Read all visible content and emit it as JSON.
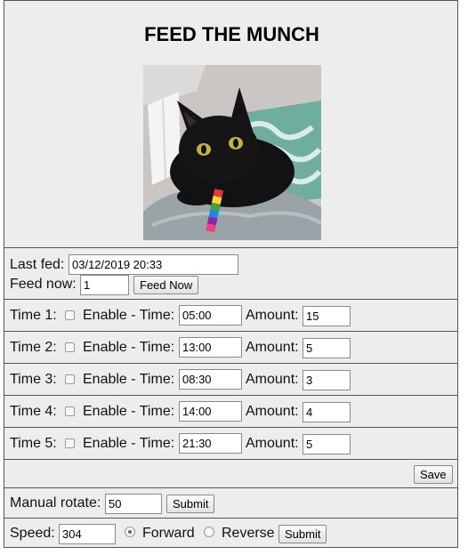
{
  "header": {
    "title": "FEED THE MUNCH"
  },
  "feed": {
    "last_fed_label": "Last fed:",
    "last_fed_value": "03/12/2019 20:33",
    "feed_now_label": "Feed now:",
    "feed_now_value": "1",
    "feed_now_button": "Feed Now"
  },
  "schedule": [
    {
      "label": "Time 1:",
      "enable_label": "Enable - Time:",
      "time": "05:00",
      "amount_label": "Amount:",
      "amount": "15",
      "enabled": false
    },
    {
      "label": "Time 2:",
      "enable_label": "Enable - Time:",
      "time": "13:00",
      "amount_label": "Amount:",
      "amount": "5",
      "enabled": false
    },
    {
      "label": "Time 3:",
      "enable_label": "Enable - Time:",
      "time": "08:30",
      "amount_label": "Amount:",
      "amount": "3",
      "enabled": false
    },
    {
      "label": "Time 4:",
      "enable_label": "Enable - Time:",
      "time": "14:00",
      "amount_label": "Amount:",
      "amount": "4",
      "enabled": false
    },
    {
      "label": "Time 5:",
      "enable_label": "Enable - Time:",
      "time": "21:30",
      "amount_label": "Amount:",
      "amount": "5",
      "enabled": false
    }
  ],
  "save_button": "Save",
  "manual": {
    "label": "Manual rotate:",
    "value": "50",
    "submit": "Submit"
  },
  "speed": {
    "label": "Speed:",
    "value": "304",
    "forward_label": "Forward",
    "reverse_label": "Reverse",
    "selected": "forward",
    "submit": "Submit"
  }
}
